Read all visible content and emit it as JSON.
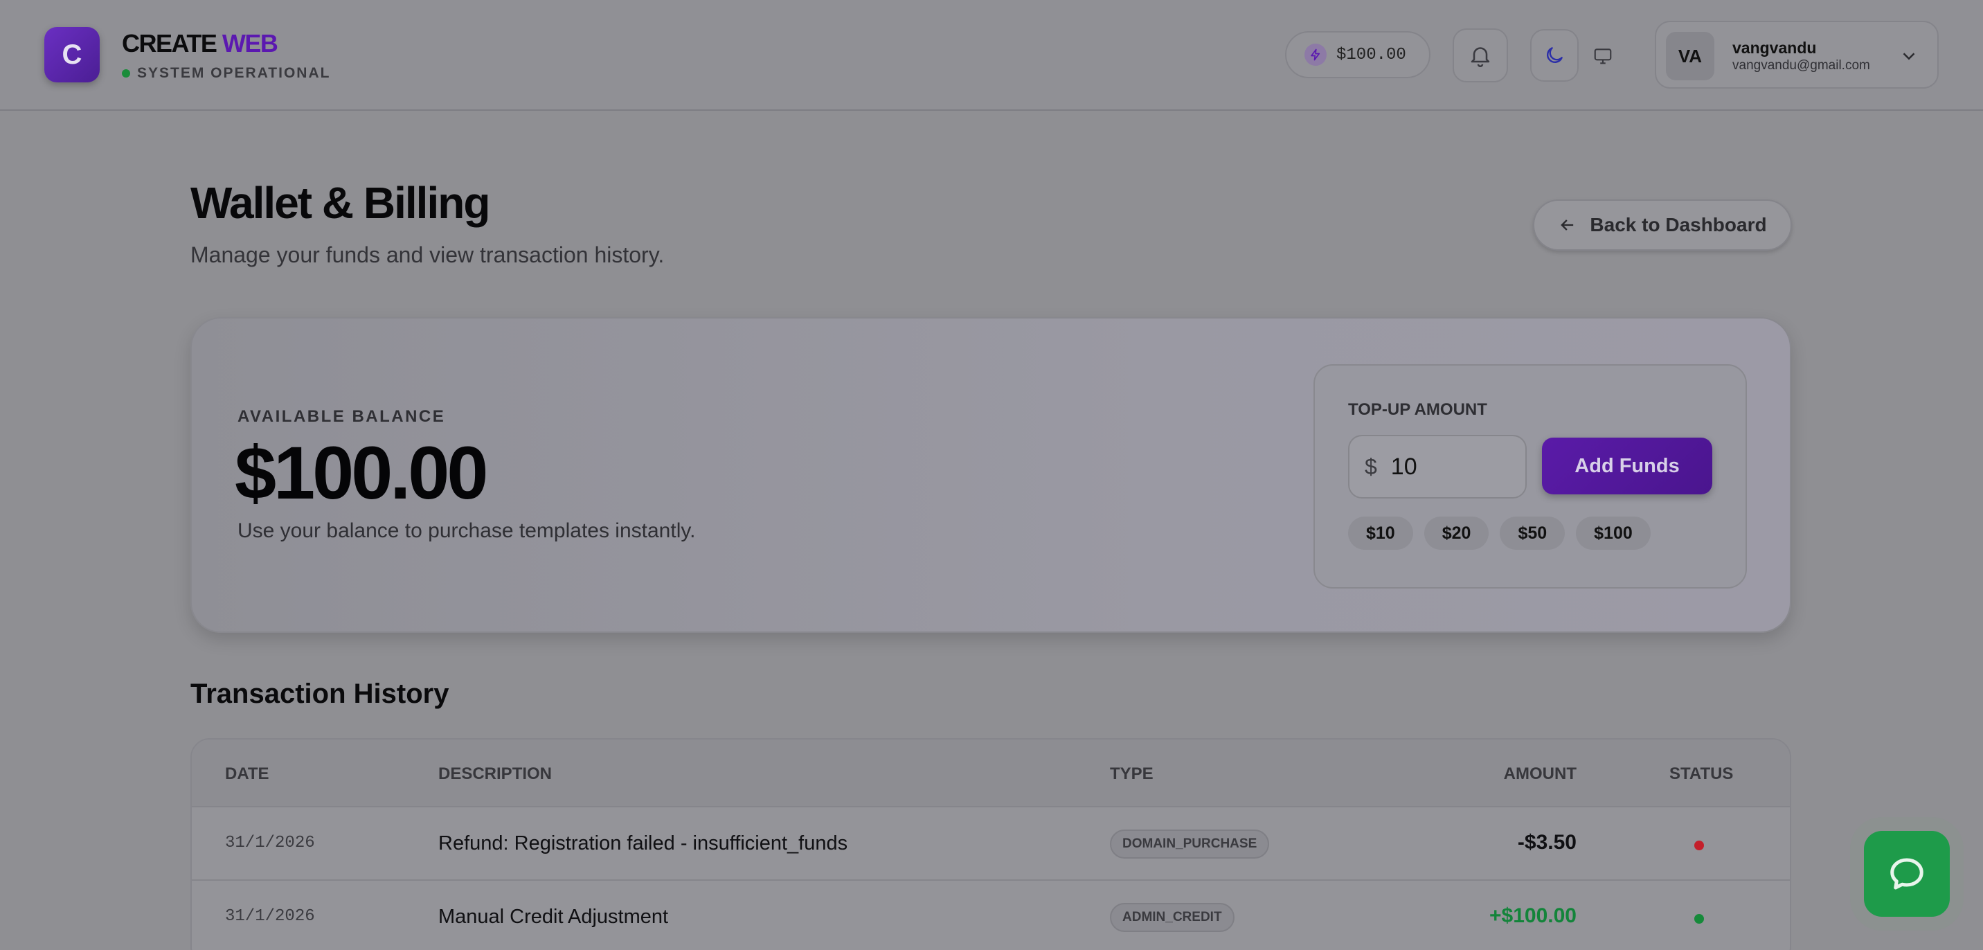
{
  "header": {
    "logo_letter": "C",
    "brand_main": "CREATE",
    "brand_accent": "WEB",
    "status_text": "SYSTEM OPERATIONAL",
    "wallet_balance": "$100.00",
    "user": {
      "initials": "VA",
      "name": "vangvandu",
      "email": "vangvandu@gmail.com"
    }
  },
  "page": {
    "title": "Wallet & Billing",
    "subtitle": "Manage your funds and view transaction history.",
    "back_label": "Back to Dashboard"
  },
  "balance": {
    "label": "AVAILABLE BALANCE",
    "value": "$100.00",
    "note": "Use your balance to purchase templates instantly."
  },
  "topup": {
    "label": "TOP-UP AMOUNT",
    "currency_symbol": "$",
    "amount_value": "10",
    "add_label": "Add Funds",
    "presets": [
      "$10",
      "$20",
      "$50",
      "$100"
    ]
  },
  "transactions": {
    "title": "Transaction History",
    "columns": {
      "date": "DATE",
      "description": "DESCRIPTION",
      "type": "TYPE",
      "amount": "AMOUNT",
      "status": "STATUS"
    },
    "rows": [
      {
        "date": "31/1/2026",
        "description": "Refund: Registration failed - insufficient_funds",
        "type": "DOMAIN_PURCHASE",
        "amount": "-$3.50",
        "amount_color": "#101013",
        "status_color": "#c41f2a"
      },
      {
        "date": "31/1/2026",
        "description": "Manual Credit Adjustment",
        "type": "ADMIN_CREDIT",
        "amount": "+$100.00",
        "amount_color": "#13843a",
        "status_color": "#168a3a"
      }
    ]
  },
  "colors": {
    "accent": "#5b18b0",
    "success": "#1a8c3a",
    "danger": "#c41f2a"
  }
}
